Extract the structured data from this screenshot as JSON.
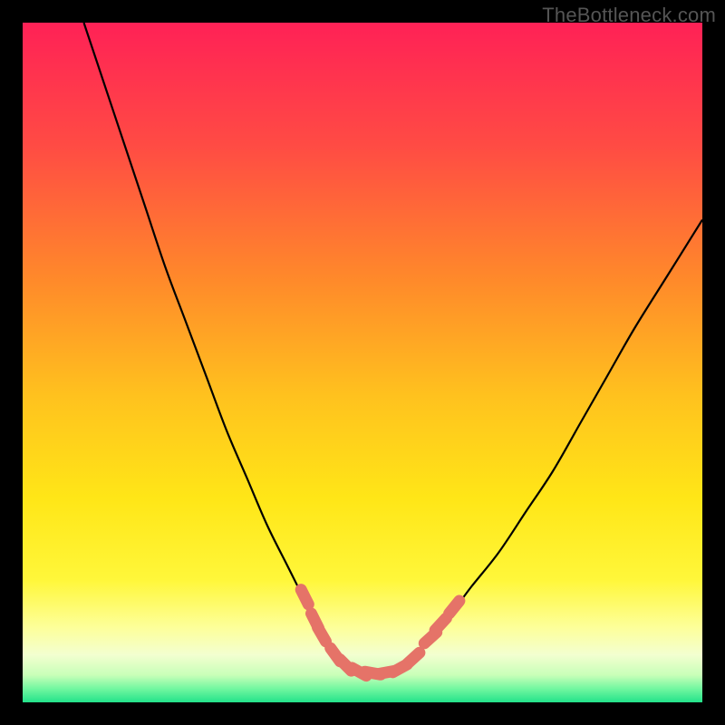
{
  "watermark": "TheBottleneck.com",
  "colors": {
    "frame": "#000000",
    "curve_stroke": "#000000",
    "marker_fill": "#e57368",
    "marker_stroke": "#d55a50",
    "gradient_stops": [
      {
        "offset": 0,
        "color": "#ff2156"
      },
      {
        "offset": 18,
        "color": "#ff4b44"
      },
      {
        "offset": 38,
        "color": "#ff8a2a"
      },
      {
        "offset": 55,
        "color": "#ffc21e"
      },
      {
        "offset": 70,
        "color": "#ffe617"
      },
      {
        "offset": 82,
        "color": "#fff73a"
      },
      {
        "offset": 89,
        "color": "#fdff9a"
      },
      {
        "offset": 93,
        "color": "#f3ffd0"
      },
      {
        "offset": 96,
        "color": "#c8ffb8"
      },
      {
        "offset": 98,
        "color": "#72f7a0"
      },
      {
        "offset": 100,
        "color": "#23e28a"
      }
    ]
  },
  "chart_data": {
    "type": "line",
    "title": "",
    "xlabel": "",
    "ylabel": "",
    "xlim": [
      0,
      100
    ],
    "ylim": [
      0,
      100
    ],
    "grid": false,
    "legend": false,
    "series": [
      {
        "name": "bottleneck-curve",
        "x": [
          9,
          12,
          15,
          18,
          21,
          24,
          27,
          30,
          33,
          36,
          39,
          41,
          43,
          45,
          47,
          49,
          51,
          53,
          55,
          57,
          60,
          63,
          66,
          70,
          74,
          78,
          82,
          86,
          90,
          95,
          100
        ],
        "y": [
          100,
          91,
          82,
          73,
          64,
          56,
          48,
          40,
          33,
          26,
          20,
          16,
          12,
          9,
          6.5,
          5,
          4.3,
          4.3,
          5,
          6.5,
          9.5,
          13,
          17,
          22,
          28,
          34,
          41,
          48,
          55,
          63,
          71
        ]
      }
    ],
    "markers": {
      "name": "threshold-markers",
      "points": [
        {
          "x": 41.5,
          "y": 15.5
        },
        {
          "x": 43.0,
          "y": 12.0
        },
        {
          "x": 44.0,
          "y": 10.0
        },
        {
          "x": 46.0,
          "y": 7.0
        },
        {
          "x": 47.5,
          "y": 5.5
        },
        {
          "x": 49.5,
          "y": 4.5
        },
        {
          "x": 51.5,
          "y": 4.3
        },
        {
          "x": 53.5,
          "y": 4.4
        },
        {
          "x": 55.5,
          "y": 5.0
        },
        {
          "x": 57.5,
          "y": 6.5
        },
        {
          "x": 60.0,
          "y": 9.5
        },
        {
          "x": 61.5,
          "y": 11.5
        },
        {
          "x": 63.5,
          "y": 14.0
        }
      ]
    }
  }
}
